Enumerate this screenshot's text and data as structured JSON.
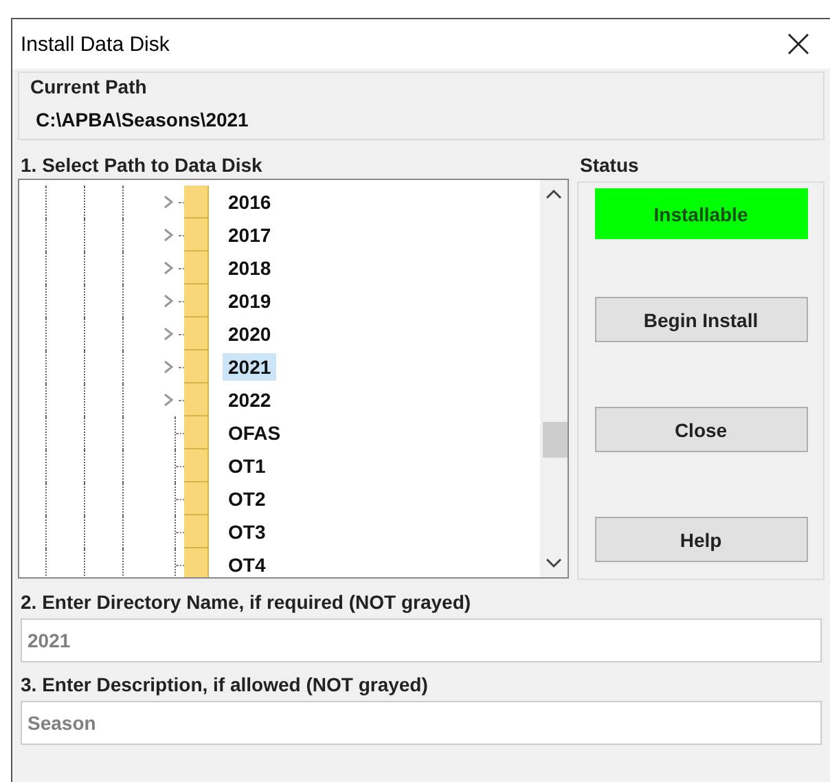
{
  "window": {
    "title": "Install Data Disk"
  },
  "current_path": {
    "label": "Current Path",
    "value": "C:\\APBA\\Seasons\\2021"
  },
  "select_path": {
    "label": "1. Select Path to Data Disk",
    "items": [
      {
        "label": "2016",
        "expandable": true,
        "selected": false
      },
      {
        "label": "2017",
        "expandable": true,
        "selected": false
      },
      {
        "label": "2018",
        "expandable": true,
        "selected": false
      },
      {
        "label": "2019",
        "expandable": true,
        "selected": false
      },
      {
        "label": "2020",
        "expandable": true,
        "selected": false
      },
      {
        "label": "2021",
        "expandable": true,
        "selected": true
      },
      {
        "label": "2022",
        "expandable": true,
        "selected": false
      },
      {
        "label": "OFAS",
        "expandable": false,
        "selected": false
      },
      {
        "label": "OT1",
        "expandable": false,
        "selected": false
      },
      {
        "label": "OT2",
        "expandable": false,
        "selected": false
      },
      {
        "label": "OT3",
        "expandable": false,
        "selected": false
      },
      {
        "label": "OT4",
        "expandable": false,
        "selected": false
      }
    ]
  },
  "status": {
    "label": "Status",
    "value": "Installable",
    "color": "#00ff00"
  },
  "buttons": [
    "Begin Install",
    "Close",
    "Help"
  ],
  "directory_name": {
    "label": "2. Enter Directory Name, if required (NOT grayed)",
    "value": "2021",
    "disabled": true
  },
  "description": {
    "label": "3. Enter Description, if allowed (NOT grayed)",
    "value": "Season",
    "disabled": true
  }
}
